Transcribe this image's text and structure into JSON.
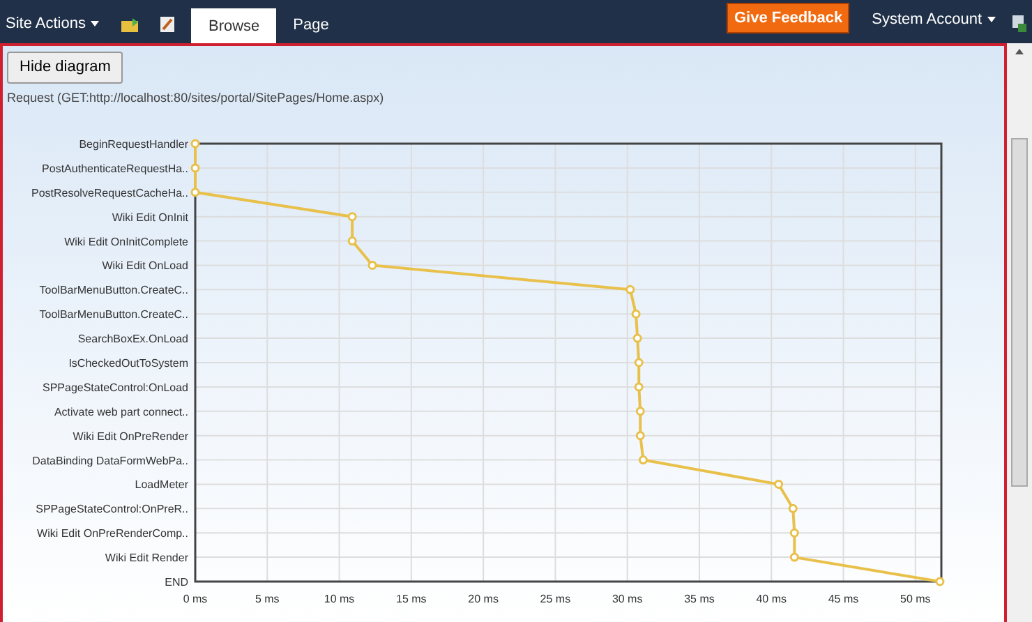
{
  "top_bar": {
    "site_actions": "Site Actions",
    "tabs": [
      {
        "label": "Browse",
        "selected": true
      },
      {
        "label": "Page",
        "selected": false
      }
    ],
    "feedback_button": "Give Feedback",
    "account": "System Account"
  },
  "hide_button": "Hide diagram",
  "request": "Request (GET:http://localhost:80/sites/portal/SitePages/Home.aspx)",
  "chart_data": {
    "type": "line",
    "categories": [
      "BeginRequestHandler",
      "PostAuthenticateRequestHa..",
      "PostResolveRequestCacheHa..",
      "Wiki Edit OnInit",
      "Wiki Edit OnInitComplete",
      "Wiki Edit OnLoad",
      "ToolBarMenuButton.CreateC..",
      "ToolBarMenuButton.CreateC..",
      "SearchBoxEx.OnLoad",
      "IsCheckedOutToSystem",
      "SPPageStateControl:OnLoad",
      "Activate web part connect..",
      "Wiki Edit OnPreRender",
      "DataBinding DataFormWebPa..",
      "LoadMeter",
      "SPPageStateControl:OnPreR..",
      "Wiki Edit OnPreRenderComp..",
      "Wiki Edit Render",
      "END"
    ],
    "orientation": "horizontal",
    "grid": true,
    "series": [
      {
        "color": "#e8c04a",
        "marker": true,
        "values": [
          0,
          0,
          0,
          10.9,
          10.9,
          12.3,
          30.2,
          30.6,
          30.7,
          30.8,
          30.8,
          30.9,
          30.9,
          31.1,
          40.5,
          41.5,
          41.6,
          41.6,
          51.7
        ]
      }
    ],
    "xlim": [
      0,
      51.8
    ],
    "xticks": [
      {
        "value": 0,
        "label": "0 ms"
      },
      {
        "value": 5,
        "label": "5 ms"
      },
      {
        "value": 10,
        "label": "10 ms"
      },
      {
        "value": 15,
        "label": "15 ms"
      },
      {
        "value": 20,
        "label": "20 ms"
      },
      {
        "value": 25,
        "label": "25 ms"
      },
      {
        "value": 30,
        "label": "30 ms"
      },
      {
        "value": 35,
        "label": "35 ms"
      },
      {
        "value": 40,
        "label": "40 ms"
      },
      {
        "value": 45,
        "label": "45 ms"
      },
      {
        "value": 50,
        "label": "50 ms"
      }
    ]
  }
}
